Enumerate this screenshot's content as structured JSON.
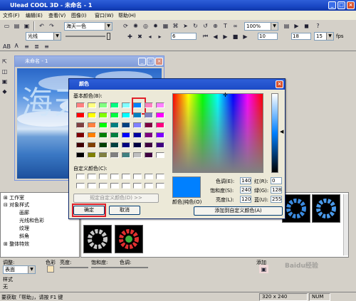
{
  "app": {
    "title": "Ulead COOL 3D - 未命名 - 1"
  },
  "menu": [
    "文件(F)",
    "编辑(E)",
    "查看(V)",
    "图像(I)",
    "窗口(W)",
    "帮助(H)"
  ],
  "toolbar": {
    "preset_combo": "海天一色",
    "light_combo": "光线",
    "zoom_combo": "100%",
    "frame_value": "6",
    "frame_total": "18",
    "fps_value": "15",
    "fps_label": "fps",
    "frame_value2": "10"
  },
  "document": {
    "title": "未命名 - 1",
    "canvas_text": "海天"
  },
  "tree": {
    "items": [
      "工作室",
      "对象样式",
      "画廊",
      "光线和色彩",
      "纹理",
      "斜角",
      "整体特效"
    ]
  },
  "props": {
    "label_adjust": "调整:",
    "adjust_value": "表面",
    "label_color": "色彩",
    "label_brightness": "亮度:",
    "label_saturation": "饱和度:",
    "label_hue": "色调:",
    "label_add": "添加",
    "label_style": "样式",
    "style_value": "无"
  },
  "status": {
    "help": "要获取「帮助」，请按 F1 键",
    "size": "320 x 240",
    "mode": "NUM"
  },
  "dialog": {
    "title": "颜色",
    "basic_colors_label": "基本颜色(B):",
    "custom_colors_label": "自定义颜色(C):",
    "define_custom_button": "规定自定义颜色(D) >>",
    "ok_button": "确定",
    "cancel_button": "取消",
    "color_solid_label": "颜色|纯色(O)",
    "add_custom_button": "添加到自定义颜色(A)",
    "hue_label": "色调(E):",
    "hue_value": "140",
    "sat_label": "饱和度(S):",
    "sat_value": "240",
    "lum_label": "亮度(L):",
    "lum_value": "120",
    "red_label": "红(R):",
    "red_value": "0",
    "green_label": "绿(G):",
    "green_value": "128",
    "blue_label": "蓝(U):",
    "blue_value": "255",
    "selected_color": "#0080ff",
    "basic_colors": [
      "#ff8080",
      "#ffff80",
      "#80ff80",
      "#00ff80",
      "#80ffff",
      "#0080ff",
      "#ff80c0",
      "#ff80ff",
      "#ff0000",
      "#ffff00",
      "#80ff00",
      "#00ff40",
      "#00ffff",
      "#0080c0",
      "#8080c0",
      "#ff00ff",
      "#804040",
      "#ff8040",
      "#00ff00",
      "#008080",
      "#004080",
      "#8080ff",
      "#800040",
      "#ff0080",
      "#800000",
      "#ff8000",
      "#008000",
      "#008040",
      "#0000ff",
      "#0000a0",
      "#800080",
      "#8000ff",
      "#400000",
      "#804000",
      "#004000",
      "#004040",
      "#000080",
      "#000040",
      "#400040",
      "#400080",
      "#000000",
      "#808000",
      "#808040",
      "#808080",
      "#408080",
      "#c0c0c0",
      "#400040",
      "#ffffff"
    ]
  },
  "watermark": "Baidu经验"
}
